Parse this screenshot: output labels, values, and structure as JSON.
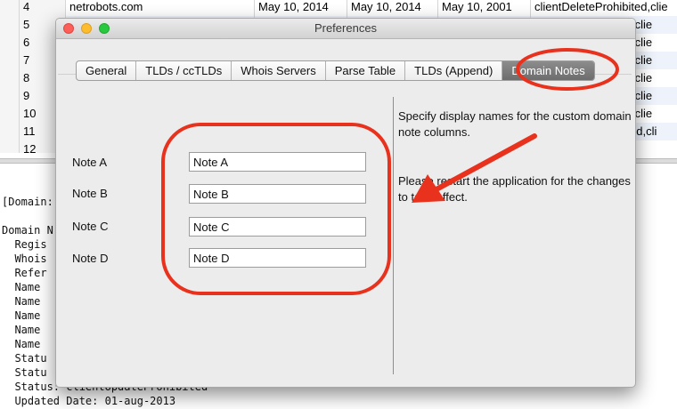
{
  "table": {
    "rows": [
      {
        "num": "4",
        "domain": "netrobots.com",
        "d1": "May 10, 2014",
        "d2": "May 10, 2014",
        "d3": "May 10, 2001",
        "status": "clientDeleteProhibited,clie"
      },
      {
        "num": "5",
        "status": "ited,clie"
      },
      {
        "num": "6",
        "status": "ited,clie"
      },
      {
        "num": "7",
        "status": "ited,clie"
      },
      {
        "num": "8",
        "status": "ited,clie"
      },
      {
        "num": "9",
        "status": "ited,clie"
      },
      {
        "num": "10",
        "status": "ited,clie"
      },
      {
        "num": "11",
        "status": "ohibited,cli"
      },
      {
        "num": "12",
        "status": ""
      }
    ]
  },
  "whois": {
    "lines": [
      "[Domain:",
      "Domain N",
      "  Regis",
      "  Whois",
      "  Refer",
      "  Name",
      "  Name",
      "  Name",
      "  Name",
      "  Name",
      "  Statu",
      "  Statu",
      "  Status: clientUpdateProhibited",
      "  Updated Date: 01-aug-2013"
    ]
  },
  "window": {
    "title": "Preferences",
    "tabs": [
      "General",
      "TLDs / ccTLDs",
      "Whois Servers",
      "Parse Table",
      "TLDs (Append)",
      "Domain Notes"
    ],
    "selected_tab": "Domain Notes"
  },
  "notes": [
    {
      "label": "Note A",
      "value": "Note A"
    },
    {
      "label": "Note B",
      "value": "Note B"
    },
    {
      "label": "Note C",
      "value": "Note C"
    },
    {
      "label": "Note D",
      "value": "Note D"
    }
  ],
  "help": {
    "line1": "Specify display names for the custom domain note columns.",
    "line2": "Please restart the application for the changes to take effect."
  },
  "annotation": {
    "color": "#e8321e"
  }
}
